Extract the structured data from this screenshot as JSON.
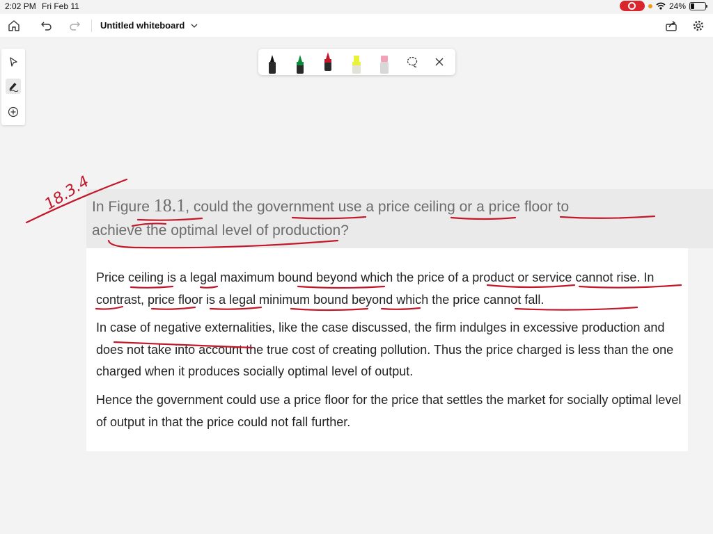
{
  "status_bar": {
    "time": "2:02 PM",
    "date": "Fri Feb 11",
    "battery": "24%"
  },
  "toolbar": {
    "title": "Untitled whiteboard"
  },
  "annotation": {
    "handwritten_label": "18.3.4"
  },
  "question": {
    "line1_before": "In Figure ",
    "figure_number": "18.1",
    "line1_after": ", could the government use a price ceiling or a price floor to",
    "line2": "achieve the optimal level of production?"
  },
  "answer": {
    "p1": "Price ceiling is a legal maximum bound beyond which the price of a product or service cannot rise. In contrast, price floor is a legal minimum bound beyond which the price cannot fall.",
    "p2": "In case of negative externalities, like the case discussed, the firm indulges in excessive production and does not take into account the true cost of creating pollution. Thus the price charged is less than the one charged when it produces socially optimal level of output.",
    "p3": "Hence the government could use a price floor for the price that settles the market for socially optimal level of output in that the price could not fall further."
  },
  "colors": {
    "ink_red": "#c2182b",
    "record_red": "#d9252c",
    "question_text": "#6d6d6d"
  }
}
